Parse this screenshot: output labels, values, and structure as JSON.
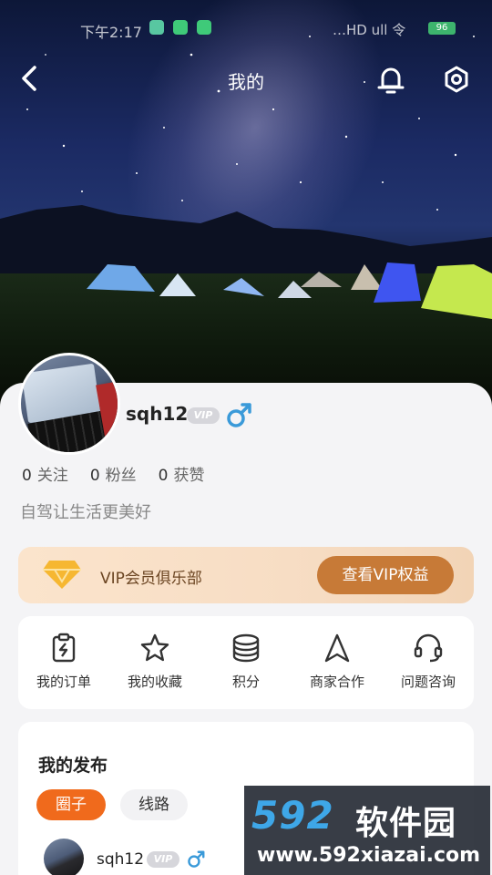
{
  "status_bar": {
    "time": "下午2:17",
    "signal_text": "…HD ull 令",
    "battery": "96"
  },
  "nav": {
    "title": "我的"
  },
  "profile": {
    "username": "sqh12",
    "vip_badge": "VIP",
    "stats": [
      {
        "value": "0",
        "label": "关注"
      },
      {
        "value": "0",
        "label": "粉丝"
      },
      {
        "value": "0",
        "label": "获赞"
      }
    ],
    "bio": "自驾让生活更美好"
  },
  "vip_banner": {
    "label": "VIP会员俱乐部",
    "button": "查看VIP权益"
  },
  "menu": [
    {
      "label": "我的订单",
      "icon": "order-icon"
    },
    {
      "label": "我的收藏",
      "icon": "star-icon"
    },
    {
      "label": "积分",
      "icon": "coins-icon"
    },
    {
      "label": "商家合作",
      "icon": "navigation-icon"
    },
    {
      "label": "问题咨询",
      "icon": "headset-icon"
    }
  ],
  "posts": {
    "title": "我的发布",
    "tabs": [
      "圈子",
      "线路"
    ],
    "item": {
      "username": "sqh12",
      "vip": "VIP"
    }
  },
  "watermark": {
    "logo": "592",
    "brand": "软件园",
    "url": "www.592xiazai.com"
  },
  "colors": {
    "accent": "#f06a1c",
    "vip_button": "#c77a37",
    "male": "#3a9ad9"
  }
}
